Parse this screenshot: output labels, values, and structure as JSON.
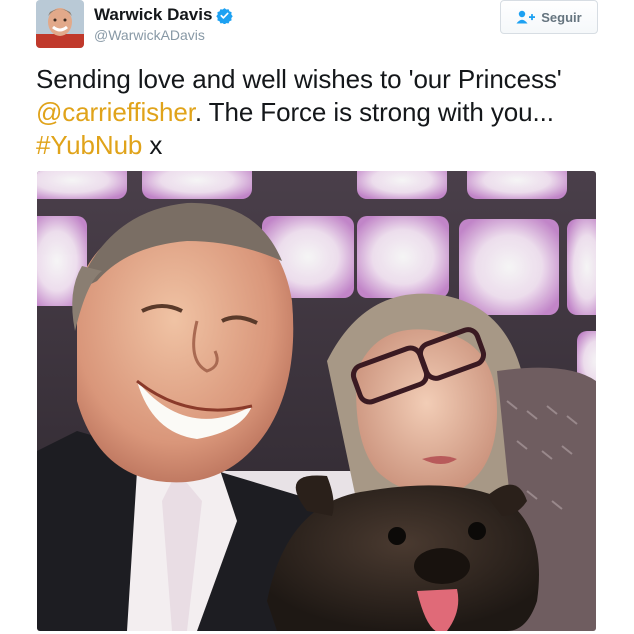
{
  "author": {
    "display_name": "Warwick Davis",
    "handle": "@WarwickADavis",
    "verified": true,
    "verified_icon": "verified-badge-icon",
    "avatar_icon": "avatar-photo"
  },
  "follow_button": {
    "label": "Seguir",
    "icon": "add-user-icon"
  },
  "tweet": {
    "text_1": "Sending love and well wishes to 'our Princess' ",
    "mention": "@carrieffisher",
    "text_2": ". The Force is strong with you...",
    "hashtag": "#YubNub",
    "text_3": " x"
  },
  "colors": {
    "link": "#E0A31A",
    "verified": "#1DA1F2",
    "text": "#14171A",
    "muted": "#8899A6"
  },
  "media": {
    "type": "photo",
    "alt_icon": "selfie-photo"
  }
}
